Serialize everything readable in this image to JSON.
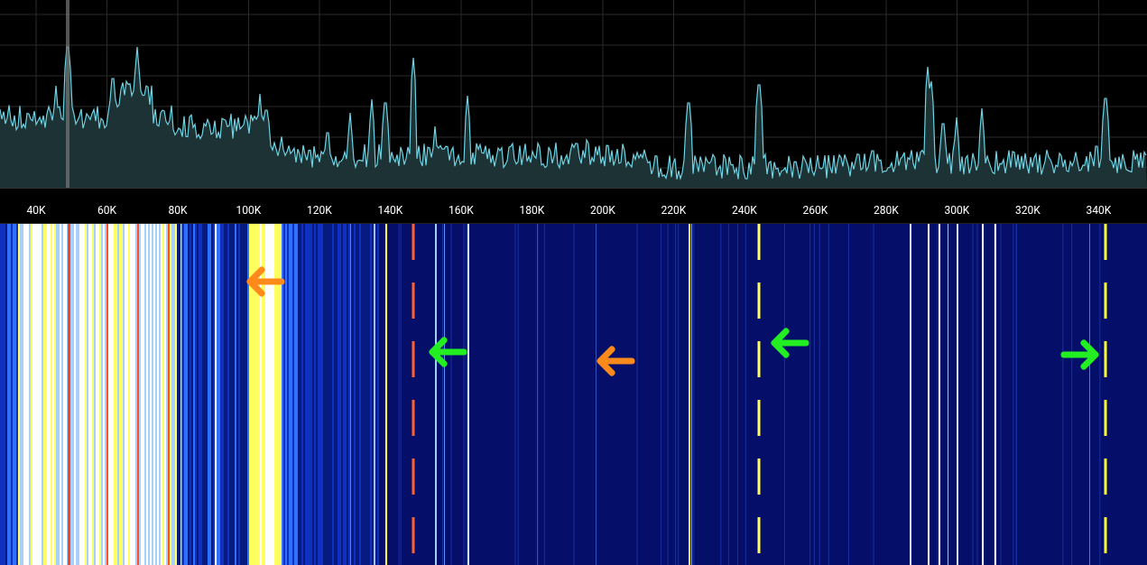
{
  "frequency_axis": {
    "labels": [
      "40K",
      "60K",
      "80K",
      "100K",
      "120K",
      "140K",
      "160K",
      "180K",
      "200K",
      "220K",
      "240K",
      "260K",
      "280K",
      "300K",
      "320K",
      "340K"
    ]
  },
  "markers": [
    {
      "kind": "left-arrow",
      "color": "#ff8a1c"
    },
    {
      "kind": "left-arrow",
      "color": "#22ee22"
    },
    {
      "kind": "left-arrow",
      "color": "#ff8a1c"
    },
    {
      "kind": "left-arrow",
      "color": "#22ee22"
    },
    {
      "kind": "right-arrow",
      "color": "#22ee22"
    }
  ]
}
